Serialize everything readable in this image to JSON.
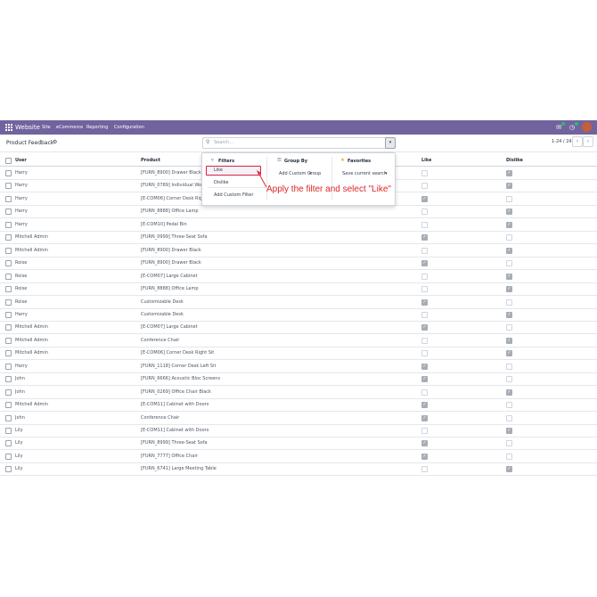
{
  "navbar": {
    "brand": "Website",
    "menu": [
      "Site",
      "eCommerce",
      "Reporting",
      "Configuration"
    ],
    "icons": [
      "apps-grid-icon",
      "chat-icon",
      "activity-clock-icon",
      "user-avatar"
    ]
  },
  "control": {
    "title": "Product Feedback",
    "search_placeholder": "Search...",
    "pager": "1-24 / 24"
  },
  "table": {
    "headers": [
      "User",
      "Product",
      "Like",
      "Dislike"
    ],
    "rows": [
      {
        "user": "Harry",
        "product": "[FURN_8900] Drawer Black",
        "like": false,
        "dislike": true
      },
      {
        "user": "Harry",
        "product": "[FURN_0789] Individual Workplace",
        "like": false,
        "dislike": true
      },
      {
        "user": "Harry",
        "product": "[E-COM06] Corner Desk Right Sit",
        "like": true,
        "dislike": false
      },
      {
        "user": "Harry",
        "product": "[FURN_8888] Office Lamp",
        "like": false,
        "dislike": true
      },
      {
        "user": "Harry",
        "product": "[E-COM10] Pedal Bin",
        "like": false,
        "dislike": true
      },
      {
        "user": "Mitchell Admin",
        "product": "[FURN_0999] Three-Seat Sofa",
        "like": true,
        "dislike": false
      },
      {
        "user": "Mitchell Admin",
        "product": "[FURN_8900] Drawer Black",
        "like": false,
        "dislike": true
      },
      {
        "user": "Roise",
        "product": "[FURN_8900] Drawer Black",
        "like": true,
        "dislike": false
      },
      {
        "user": "Roise",
        "product": "[E-COM07] Large Cabinet",
        "like": false,
        "dislike": true
      },
      {
        "user": "Roise",
        "product": "[FURN_8888] Office Lamp",
        "like": false,
        "dislike": true
      },
      {
        "user": "Roise",
        "product": "Customizable Desk",
        "like": true,
        "dislike": false
      },
      {
        "user": "Harry",
        "product": "Customizable Desk",
        "like": false,
        "dislike": true
      },
      {
        "user": "Mitchell Admin",
        "product": "[E-COM07] Large Cabinet",
        "like": true,
        "dislike": false
      },
      {
        "user": "Mitchell Admin",
        "product": "Conference Chair",
        "like": false,
        "dislike": true
      },
      {
        "user": "Mitchell Admin",
        "product": "[E-COM06] Corner Desk Right Sit",
        "like": false,
        "dislike": true
      },
      {
        "user": "Harry",
        "product": "[FURN_1118] Corner Desk Left Sit",
        "like": true,
        "dislike": false
      },
      {
        "user": "John",
        "product": "[FURN_6666] Acoustic Bloc Screens",
        "like": true,
        "dislike": false
      },
      {
        "user": "John",
        "product": "[FURN_0269] Office Chair Black",
        "like": false,
        "dislike": true
      },
      {
        "user": "Mitchell Admin",
        "product": "[E-COM11] Cabinet with Doors",
        "like": true,
        "dislike": false
      },
      {
        "user": "John",
        "product": "Conference Chair",
        "like": true,
        "dislike": false
      },
      {
        "user": "Lily",
        "product": "[E-COM11] Cabinet with Doors",
        "like": false,
        "dislike": true
      },
      {
        "user": "Lily",
        "product": "[FURN_8999] Three-Seat Sofa",
        "like": true,
        "dislike": false
      },
      {
        "user": "Lily",
        "product": "[FURN_7777] Office Chair",
        "like": true,
        "dislike": false
      },
      {
        "user": "Lily",
        "product": "[FURN_6741] Large Meeting Table",
        "like": false,
        "dislike": true
      }
    ]
  },
  "dropdown": {
    "filters_label": "Filters",
    "filters": [
      "Like",
      "Dislike"
    ],
    "add_custom_filter": "Add Custom Filter",
    "groupby_label": "Group By",
    "add_custom_group": "Add Custom Group",
    "favorites_label": "Favorites",
    "save_search": "Save current search"
  },
  "annotation": "Apply the filter and select \"Like\"",
  "colors": {
    "navbar": "#71639e",
    "annotation": "#dc2626",
    "checked": "#a8adb5"
  }
}
